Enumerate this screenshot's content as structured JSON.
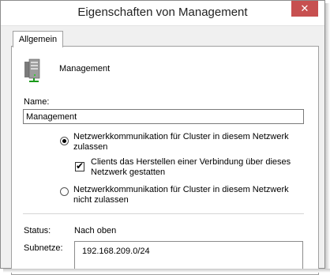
{
  "dialog": {
    "title": "Eigenschaften von Management",
    "close_symbol": "✕"
  },
  "tabs": [
    {
      "label": "Allgemein"
    }
  ],
  "header": {
    "icon": "server-icon",
    "network_name": "Management"
  },
  "name_field": {
    "label": "Name:",
    "value": "Management"
  },
  "options": {
    "allow": {
      "line1": "Netzwerkkommunikation für Cluster in diesem Netzwerk",
      "line2": "zulassen",
      "checked": true
    },
    "clients": {
      "line1": "Clients das Herstellen einer Verbindung über dieses",
      "line2": "Netzwerk gestatten",
      "checked": true
    },
    "deny": {
      "line1": "Netzwerkkommunikation für Cluster in diesem Netzwerk",
      "line2": "nicht zulassen",
      "checked": false
    }
  },
  "status": {
    "label": "Status:",
    "value": "Nach oben"
  },
  "subnets": {
    "label": "Subnetze:",
    "items": [
      "192.168.209.0/24"
    ]
  },
  "colors": {
    "close_button": "#c75050",
    "dialog_bg": "#f0f0f0",
    "panel_bg": "#ffffff"
  }
}
